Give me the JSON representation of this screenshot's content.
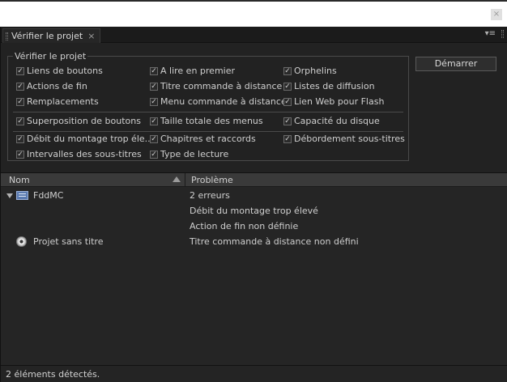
{
  "window": {
    "close_glyph": "×"
  },
  "tab": {
    "title": "Vérifier le projet",
    "close_glyph": "×",
    "menu_glyph": "▾≡"
  },
  "check_group": {
    "legend": "Vérifier le projet",
    "items": [
      {
        "label": "Liens de boutons",
        "checked": true
      },
      {
        "label": "Actions de fin",
        "checked": true
      },
      {
        "label": "Remplacements",
        "checked": true
      },
      {
        "label": "A lire en premier",
        "checked": true
      },
      {
        "label": "Titre commande à distance",
        "checked": true
      },
      {
        "label": "Menu commande à distance",
        "checked": true
      },
      {
        "label": "Orphelins",
        "checked": true
      },
      {
        "label": "Listes de diffusion",
        "checked": true
      },
      {
        "label": "Lien Web pour Flash",
        "checked": true
      },
      {
        "label": "Superposition de boutons",
        "checked": true
      },
      {
        "label": "Taille totale des menus",
        "checked": true
      },
      {
        "label": "Capacité du disque",
        "checked": true
      },
      {
        "label": "Débit du montage trop éle...",
        "checked": true
      },
      {
        "label": "Intervalles des sous-titres",
        "checked": true
      },
      {
        "label": "Chapitres et raccords",
        "checked": true
      },
      {
        "label": "Type de lecture",
        "checked": true
      },
      {
        "label": "Débordement sous-titres",
        "checked": true
      }
    ]
  },
  "start_button": "Démarrer",
  "check_glyph": "✓",
  "table": {
    "columns": [
      "Nom",
      "Problème"
    ],
    "rows": [
      {
        "name": "FddMC",
        "icon": "menu-icon",
        "problem": "2 erreurs"
      },
      {
        "name": "",
        "problem": "Débit du montage trop élevé"
      },
      {
        "name": "",
        "problem": "Action de fin non définie"
      },
      {
        "name": "Projet sans titre",
        "icon": "disc-icon",
        "problem": "Titre commande à distance non défini"
      }
    ]
  },
  "status": "2 éléments détectés."
}
